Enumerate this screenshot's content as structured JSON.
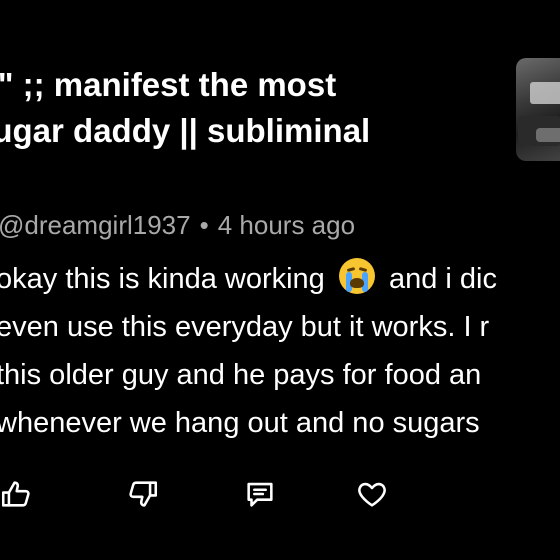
{
  "video": {
    "title_line1": "R\" ;; manifest the most",
    "title_line2": "sugar daddy || subliminal"
  },
  "comment": {
    "author": "@dreamgirl1937",
    "separator": "•",
    "time": "4 hours ago",
    "text_line1_a": "okay this is kinda working",
    "text_line1_b": "and i dic",
    "text_line2": "even use this everyday but it works. I r",
    "text_line3": "this older guy and he pays for food an",
    "text_line4": "whenever we hang out and no sugars",
    "emoji": "loudly-crying-face"
  },
  "actions": {
    "icons": [
      "thumbs-up-icon",
      "thumbs-down-icon",
      "comment-icon",
      "heart-icon"
    ]
  },
  "colors": {
    "background": "#000000",
    "text": "#ffffff",
    "meta": "#a9a9a9"
  }
}
